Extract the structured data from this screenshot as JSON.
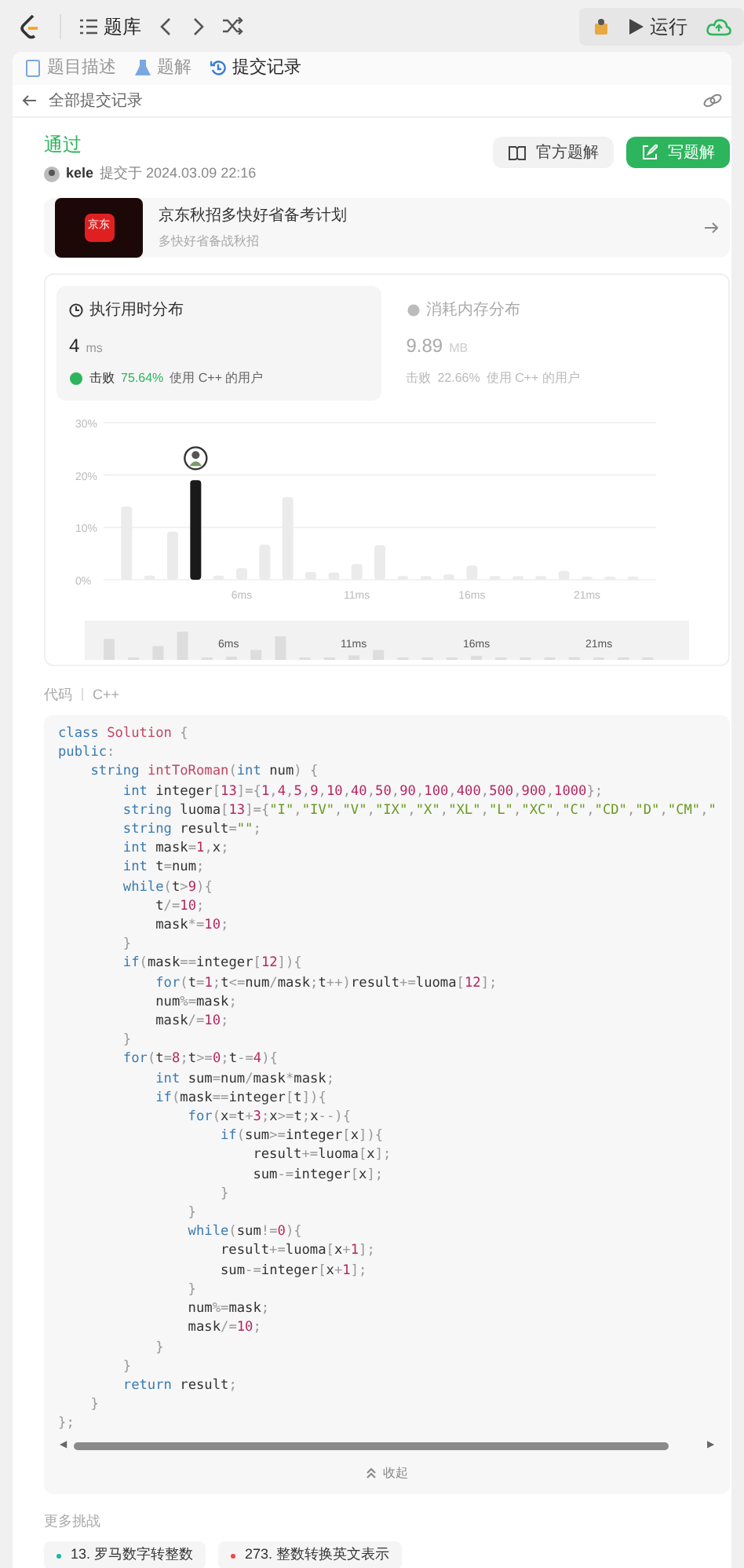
{
  "toolbar": {
    "title": "题库",
    "run_label": "运行"
  },
  "tabs": [
    {
      "label": "题目描述",
      "selected": false
    },
    {
      "label": "题解",
      "selected": false
    },
    {
      "label": "提交记录",
      "selected": true
    }
  ],
  "back_link": "全部提交记录",
  "submission": {
    "status": "通过",
    "user": "kele",
    "submitted_at": "提交于 2024.03.09 22:16",
    "buttons": [
      "官方题解",
      "写题解"
    ]
  },
  "banner": {
    "logo_text": "京东",
    "title": "京东秋招多快好省备考计划",
    "subtitle": "多快好省备战秋招"
  },
  "stats": [
    {
      "title": "执行用时分布",
      "value": "4",
      "unit": "ms",
      "beat_prefix": "击败",
      "beat": "75.64%",
      "beat_suffix": "使用 C++ 的用户",
      "selected": true
    },
    {
      "title": "消耗内存分布",
      "value": "9.89",
      "unit": "MB",
      "beat_prefix": "击败",
      "beat": "22.66%",
      "beat_suffix": "使用 C++ 的用户",
      "selected": false
    }
  ],
  "chart_data": {
    "type": "bar",
    "x": [
      1,
      2,
      3,
      4,
      5,
      6,
      7,
      8,
      9,
      10,
      11,
      12,
      13,
      14,
      15,
      16,
      17,
      18,
      19,
      20,
      21,
      22,
      23
    ],
    "values": [
      14,
      0.8,
      9.2,
      19,
      0.8,
      2.2,
      6.7,
      15.8,
      1.5,
      1.4,
      3,
      6.6,
      0.7,
      0.7,
      1,
      2.7,
      0.7,
      0.7,
      0.7,
      1.7,
      0.5,
      0.5,
      0.5
    ],
    "xlim": [
      0,
      24
    ],
    "ylim": [
      0,
      30
    ],
    "yticks": [
      {
        "value": 0,
        "label": "0%"
      },
      {
        "value": 10,
        "label": "10%"
      },
      {
        "value": 20,
        "label": "20%"
      },
      {
        "value": 30,
        "label": "30%"
      }
    ],
    "xticks": [
      {
        "value": 6,
        "label": "6ms"
      },
      {
        "value": 11,
        "label": "11ms"
      },
      {
        "value": 16,
        "label": "16ms"
      },
      {
        "value": 21,
        "label": "21ms"
      }
    ]
  },
  "bar_states": [
    {
      "selected": false
    },
    {
      "selected": false
    },
    {
      "selected": false
    },
    {
      "selected": true
    },
    {
      "selected": false
    },
    {
      "selected": false
    },
    {
      "selected": false
    },
    {
      "selected": false
    },
    {
      "selected": false
    },
    {
      "selected": false
    },
    {
      "selected": false
    },
    {
      "selected": false
    },
    {
      "selected": false
    },
    {
      "selected": false
    },
    {
      "selected": false
    },
    {
      "selected": false
    },
    {
      "selected": false
    },
    {
      "selected": false
    },
    {
      "selected": false
    },
    {
      "selected": false
    },
    {
      "selected": false
    },
    {
      "selected": false
    },
    {
      "selected": false
    }
  ],
  "overview_labels": [
    "6ms",
    "11ms",
    "16ms",
    "21ms"
  ],
  "code": {
    "label": "代码",
    "language": "C++",
    "collapse_label": "收起",
    "scroll_left": "◀",
    "scroll_right": "▶",
    "lines": [
      "class Solution {",
      "public:",
      "    string intToRoman(int num) {",
      "        int integer[13]={1,4,5,9,10,40,50,90,100,400,500,900,1000};",
      "        string luoma[13]={\"I\",\"IV\",\"V\",\"IX\",\"X\",\"XL\",\"L\",\"XC\",\"C\",\"CD\",\"D\",\"CM\",\"",
      "        string result=\"\";",
      "        int mask=1,x;",
      "        int t=num;",
      "        while(t>9){",
      "            t/=10;",
      "            mask*=10;",
      "        }",
      "        if(mask==integer[12]){",
      "            for(t=1;t<=num/mask;t++)result+=luoma[12];",
      "            num%=mask;",
      "            mask/=10;",
      "        }",
      "        for(t=8;t>=0;t-=4){",
      "            int sum=num/mask*mask;",
      "            if(mask==integer[t]){",
      "                for(x=t+3;x>=t;x--){",
      "                    if(sum>=integer[x]){",
      "                        result+=luoma[x];",
      "                        sum-=integer[x];",
      "                    }",
      "                }",
      "                while(sum!=0){",
      "                    result+=luoma[x+1];",
      "                    sum-=integer[x+1];",
      "                }",
      "                num%=mask;",
      "                mask/=10;",
      "            }",
      "        }",
      "        return result;",
      "    }",
      "};"
    ]
  },
  "more": {
    "title": "更多挑战",
    "items": [
      {
        "label": "13. 罗马数字转整数",
        "color": "#1cb8a0"
      },
      {
        "label": "273. 整数转换英文表示",
        "color": "#ef4743"
      }
    ]
  }
}
